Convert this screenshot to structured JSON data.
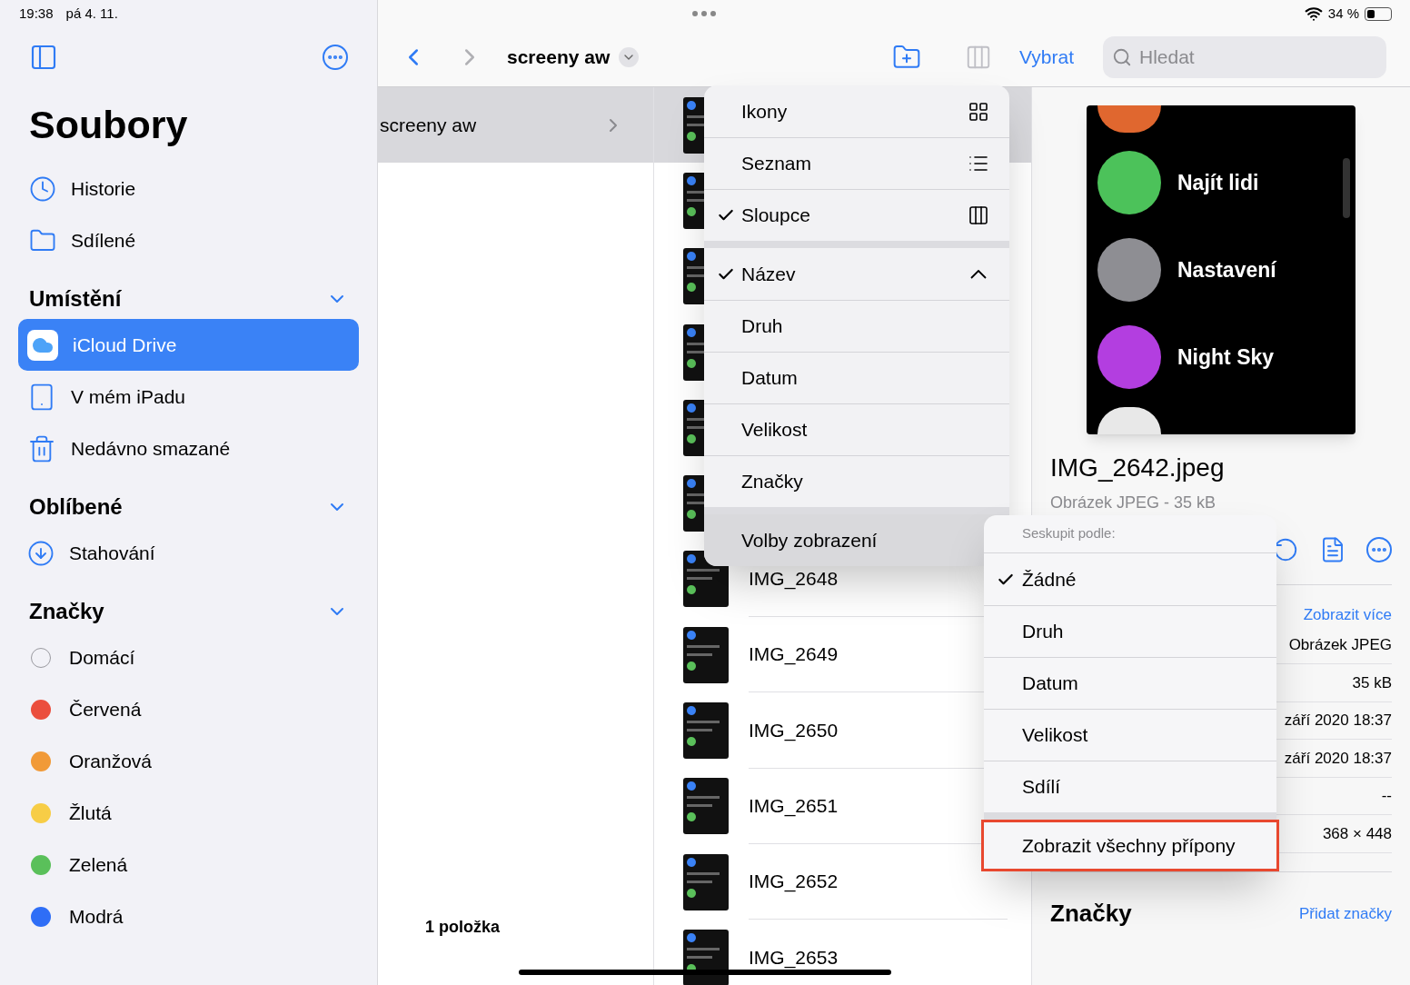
{
  "status_bar": {
    "time": "19:38",
    "date": "pá 4. 11.",
    "battery": "34 %"
  },
  "sidebar": {
    "title": "Soubory",
    "top_items": [
      {
        "label": "Historie"
      },
      {
        "label": "Sdílené"
      }
    ],
    "sections": [
      {
        "title": "Umístění",
        "expanded": true,
        "kind": "locations",
        "items": [
          {
            "label": "iCloud Drive",
            "selected": true
          },
          {
            "label": "V mém iPadu",
            "selected": false
          },
          {
            "label": "Nedávno smazané",
            "selected": false
          }
        ]
      },
      {
        "title": "Oblíbené",
        "expanded": true,
        "kind": "favorites",
        "items": [
          {
            "label": "Stahování",
            "selected": false
          }
        ]
      },
      {
        "title": "Značky",
        "expanded": true,
        "kind": "tags",
        "items": [
          {
            "label": "Domácí",
            "selected": false
          },
          {
            "label": "Červená",
            "selected": false,
            "color": "#eb4e3d"
          },
          {
            "label": "Oranžová",
            "selected": false,
            "color": "#f19a38"
          },
          {
            "label": "Žlutá",
            "selected": false,
            "color": "#f7cd46"
          },
          {
            "label": "Zelená",
            "selected": false,
            "color": "#5ac05a"
          },
          {
            "label": "Modrá",
            "selected": false,
            "color": "#2f6ef6"
          }
        ]
      }
    ]
  },
  "toolbar": {
    "folder": "screeny aw",
    "select": "Vybrat",
    "search": {
      "placeholder": "Hledat"
    }
  },
  "column_1": {
    "item": "screeny aw",
    "selected": true,
    "footer": "1 položka"
  },
  "files": [
    {
      "selected": true
    },
    {
      "selected": false
    },
    {
      "selected": false
    },
    {
      "selected": false
    },
    {
      "selected": false
    },
    {
      "selected": false
    },
    {
      "name": "IMG_2648",
      "selected": false
    },
    {
      "name": "IMG_2649",
      "selected": false
    },
    {
      "name": "IMG_2650",
      "selected": false
    },
    {
      "name": "IMG_2651",
      "selected": false
    },
    {
      "name": "IMG_2652",
      "selected": false
    },
    {
      "name": "IMG_2653",
      "selected": false
    }
  ],
  "preview": {
    "apps": [
      {
        "label": "Najít lidi",
        "color": "#4cc25a"
      },
      {
        "label": "Nastavení",
        "color": "#8e8e93"
      },
      {
        "label": "Night Sky",
        "color": "#b33ee0"
      }
    ],
    "filename": "IMG_2642.jpeg",
    "subtitle": "Obrázek JPEG - 35 kB",
    "more_link": "Zobrazit více",
    "info_values": [
      "Obrázek JPEG",
      "35 kB",
      "září 2020 18:37",
      "září 2020 18:37",
      "--",
      "368 × 448"
    ],
    "tags_title": "Značky",
    "add_tags": "Přidat značky"
  },
  "view_menu": {
    "groups": [
      [
        {
          "label": "Ikony",
          "checked": false,
          "highlighted": false
        },
        {
          "label": "Seznam",
          "checked": false,
          "highlighted": false
        },
        {
          "label": "Sloupce",
          "checked": true,
          "highlighted": false
        }
      ],
      [
        {
          "label": "Název",
          "checked": true,
          "highlighted": false
        },
        {
          "label": "Druh",
          "checked": false,
          "highlighted": false
        },
        {
          "label": "Datum",
          "checked": false,
          "highlighted": false
        },
        {
          "label": "Velikost",
          "checked": false,
          "highlighted": false
        },
        {
          "label": "Značky",
          "checked": false,
          "highlighted": false
        }
      ],
      [
        {
          "label": "Volby zobrazení",
          "checked": false,
          "highlighted": true
        }
      ]
    ]
  },
  "group_menu": {
    "header": "Seskupit podle:",
    "groups": [
      [
        {
          "label": "Žádné",
          "checked": true,
          "highlighted": false
        },
        {
          "label": "Druh",
          "checked": false,
          "highlighted": false
        },
        {
          "label": "Datum",
          "checked": false,
          "highlighted": false
        },
        {
          "label": "Velikost",
          "checked": false,
          "highlighted": false
        },
        {
          "label": "Sdílí",
          "checked": false,
          "highlighted": false
        }
      ],
      [
        {
          "label": "Zobrazit všechny přípony",
          "checked": false,
          "highlighted": true
        }
      ]
    ]
  }
}
